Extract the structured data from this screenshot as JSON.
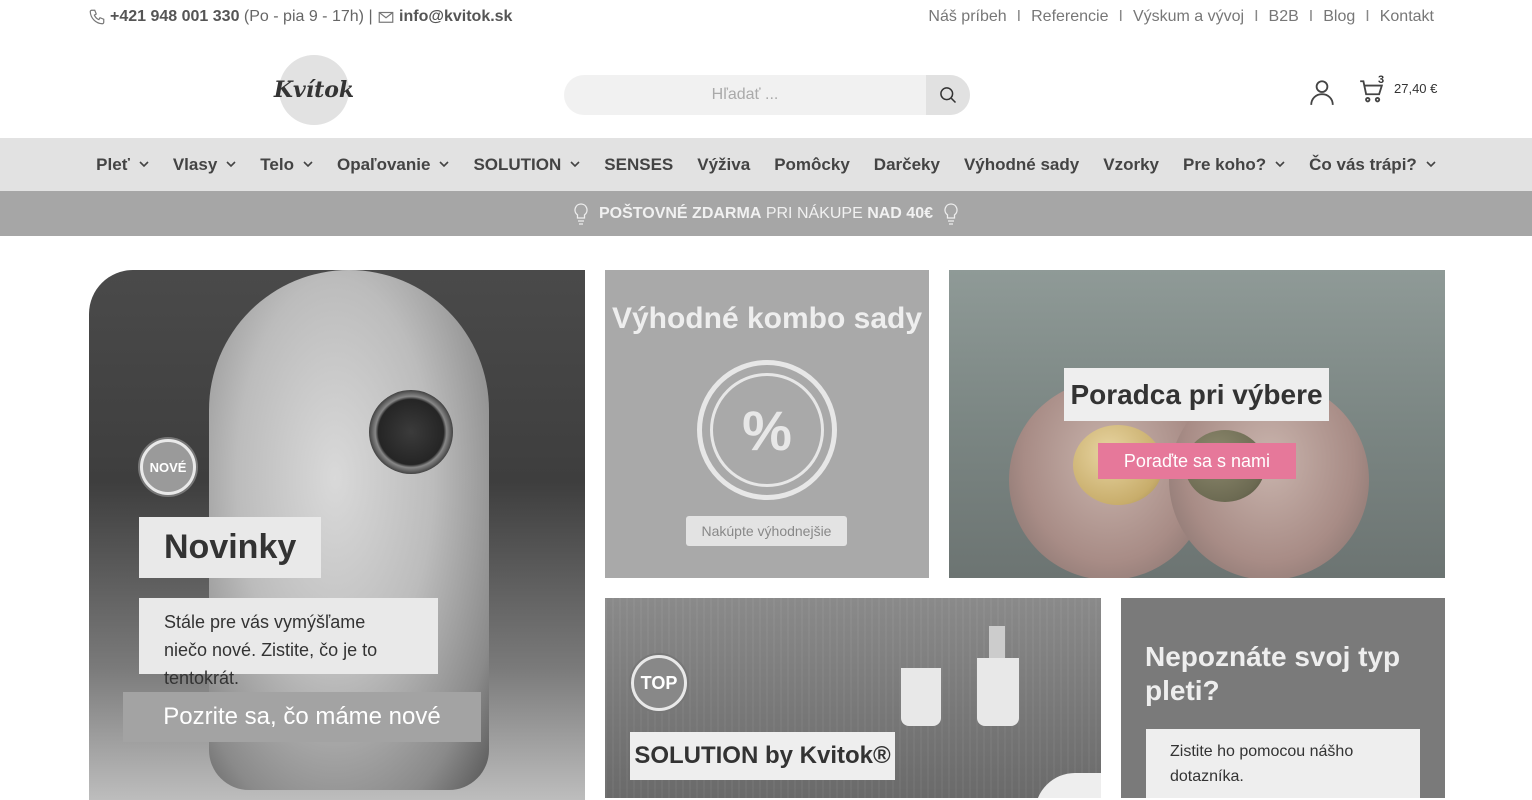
{
  "topbar": {
    "phone": "+421 948 001 330",
    "hours": "(Po - pia 9 - 17h)",
    "separator": "|",
    "email": "info@kvitok.sk",
    "links": [
      "Náš príbeh",
      "Referencie",
      "Výskum a vývoj",
      "B2B",
      "Blog",
      "Kontakt"
    ],
    "link_separator": "I"
  },
  "header": {
    "logo_text": "Kvítok",
    "search_placeholder": "Hľadať ...",
    "cart_count": "3",
    "cart_total": "27,40 €"
  },
  "nav": {
    "items": [
      {
        "label": "Pleť",
        "has_dropdown": true
      },
      {
        "label": "Vlasy",
        "has_dropdown": true
      },
      {
        "label": "Telo",
        "has_dropdown": true
      },
      {
        "label": "Opaľovanie",
        "has_dropdown": true
      },
      {
        "label": "SOLUTION",
        "has_dropdown": true
      },
      {
        "label": "SENSES",
        "has_dropdown": false
      },
      {
        "label": "Výživa",
        "has_dropdown": false
      },
      {
        "label": "Pomôcky",
        "has_dropdown": false
      },
      {
        "label": "Darčeky",
        "has_dropdown": false
      },
      {
        "label": "Výhodné sady",
        "has_dropdown": false
      },
      {
        "label": "Vzorky",
        "has_dropdown": false
      },
      {
        "label": "Pre koho?",
        "has_dropdown": true
      },
      {
        "label": "Čo vás trápi?",
        "has_dropdown": true
      }
    ]
  },
  "promo": {
    "bold1": "POŠTOVNÉ ZDARMA",
    "text": " PRI NÁKUPE ",
    "bold2": "NAD 40€"
  },
  "cards": {
    "novinky": {
      "badge": "NOVÉ",
      "title": "Novinky",
      "description": "Stále pre vás vymýšľame niečo nové. Zistite, čo je to tentokrát.",
      "cta": "Pozrite sa, čo máme nové"
    },
    "kombo": {
      "title": "Výhodné kombo sady",
      "symbol": "%",
      "cta": "Nakúpte výhodnejšie"
    },
    "poradca": {
      "title": "Poradca pri výbere",
      "cta": "Poraďte sa s nami"
    },
    "solution": {
      "badge": "TOP",
      "title": "SOLUTION by Kvitok®"
    },
    "pletkvíz": {
      "title": "Nepoznáte svoj typ pleti?",
      "description": "Zistite ho pomocou nášho dotazníka."
    }
  },
  "colors": {
    "nav_bg": "#e2e2e2",
    "promo_bg": "#a6a6a6",
    "pink_cta": "#e6789a"
  }
}
